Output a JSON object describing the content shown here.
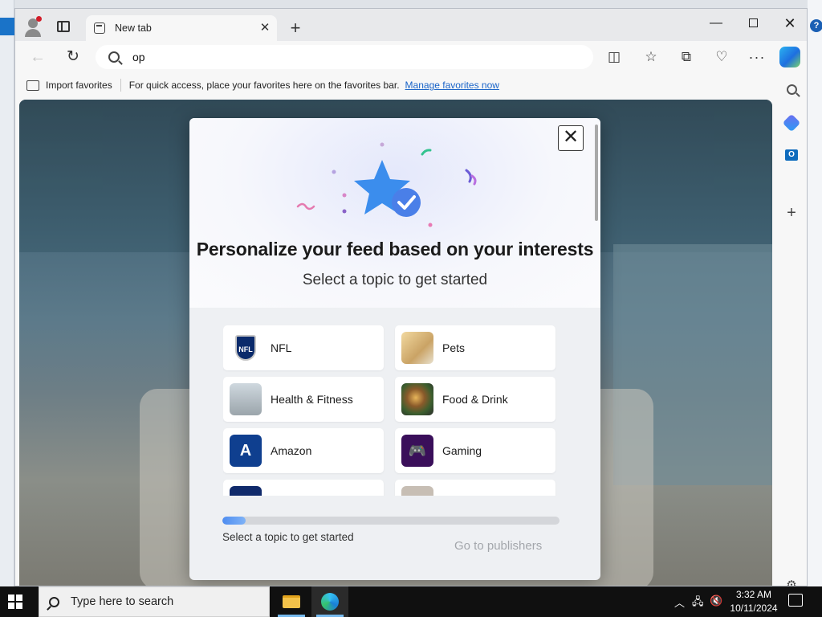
{
  "browser": {
    "tab_title": "New tab",
    "address_text": "op",
    "favorites_bar": {
      "import_label": "Import favorites",
      "message": "For quick access, place your favorites here on the favorites bar.",
      "manage_link": "Manage favorites now"
    }
  },
  "modal": {
    "headline": "Personalize your feed based on your interests",
    "subheadline": "Select a topic to get started",
    "topics": [
      {
        "label": "NFL",
        "icon": "nfl-shield-icon",
        "thumb_text": "NFL"
      },
      {
        "label": "Pets",
        "icon": "pets-photo"
      },
      {
        "label": "Health & Fitness",
        "icon": "fitness-photo"
      },
      {
        "label": "Food & Drink",
        "icon": "food-photo"
      },
      {
        "label": "Amazon",
        "icon": "amazon-icon",
        "thumb_text": "A"
      },
      {
        "label": "Gaming",
        "icon": "gaming-icon"
      }
    ],
    "progress_fraction": 0.07,
    "progress_text": "Select a topic to get started",
    "go_publishers": "Go to publishers"
  },
  "taskbar": {
    "search_placeholder": "Type here to search",
    "time": "3:32 AM",
    "date": "10/11/2024"
  },
  "colors": {
    "accent": "#1a64c8",
    "progress": "#4f8df0",
    "disabled_text": "#a3a6ab"
  }
}
